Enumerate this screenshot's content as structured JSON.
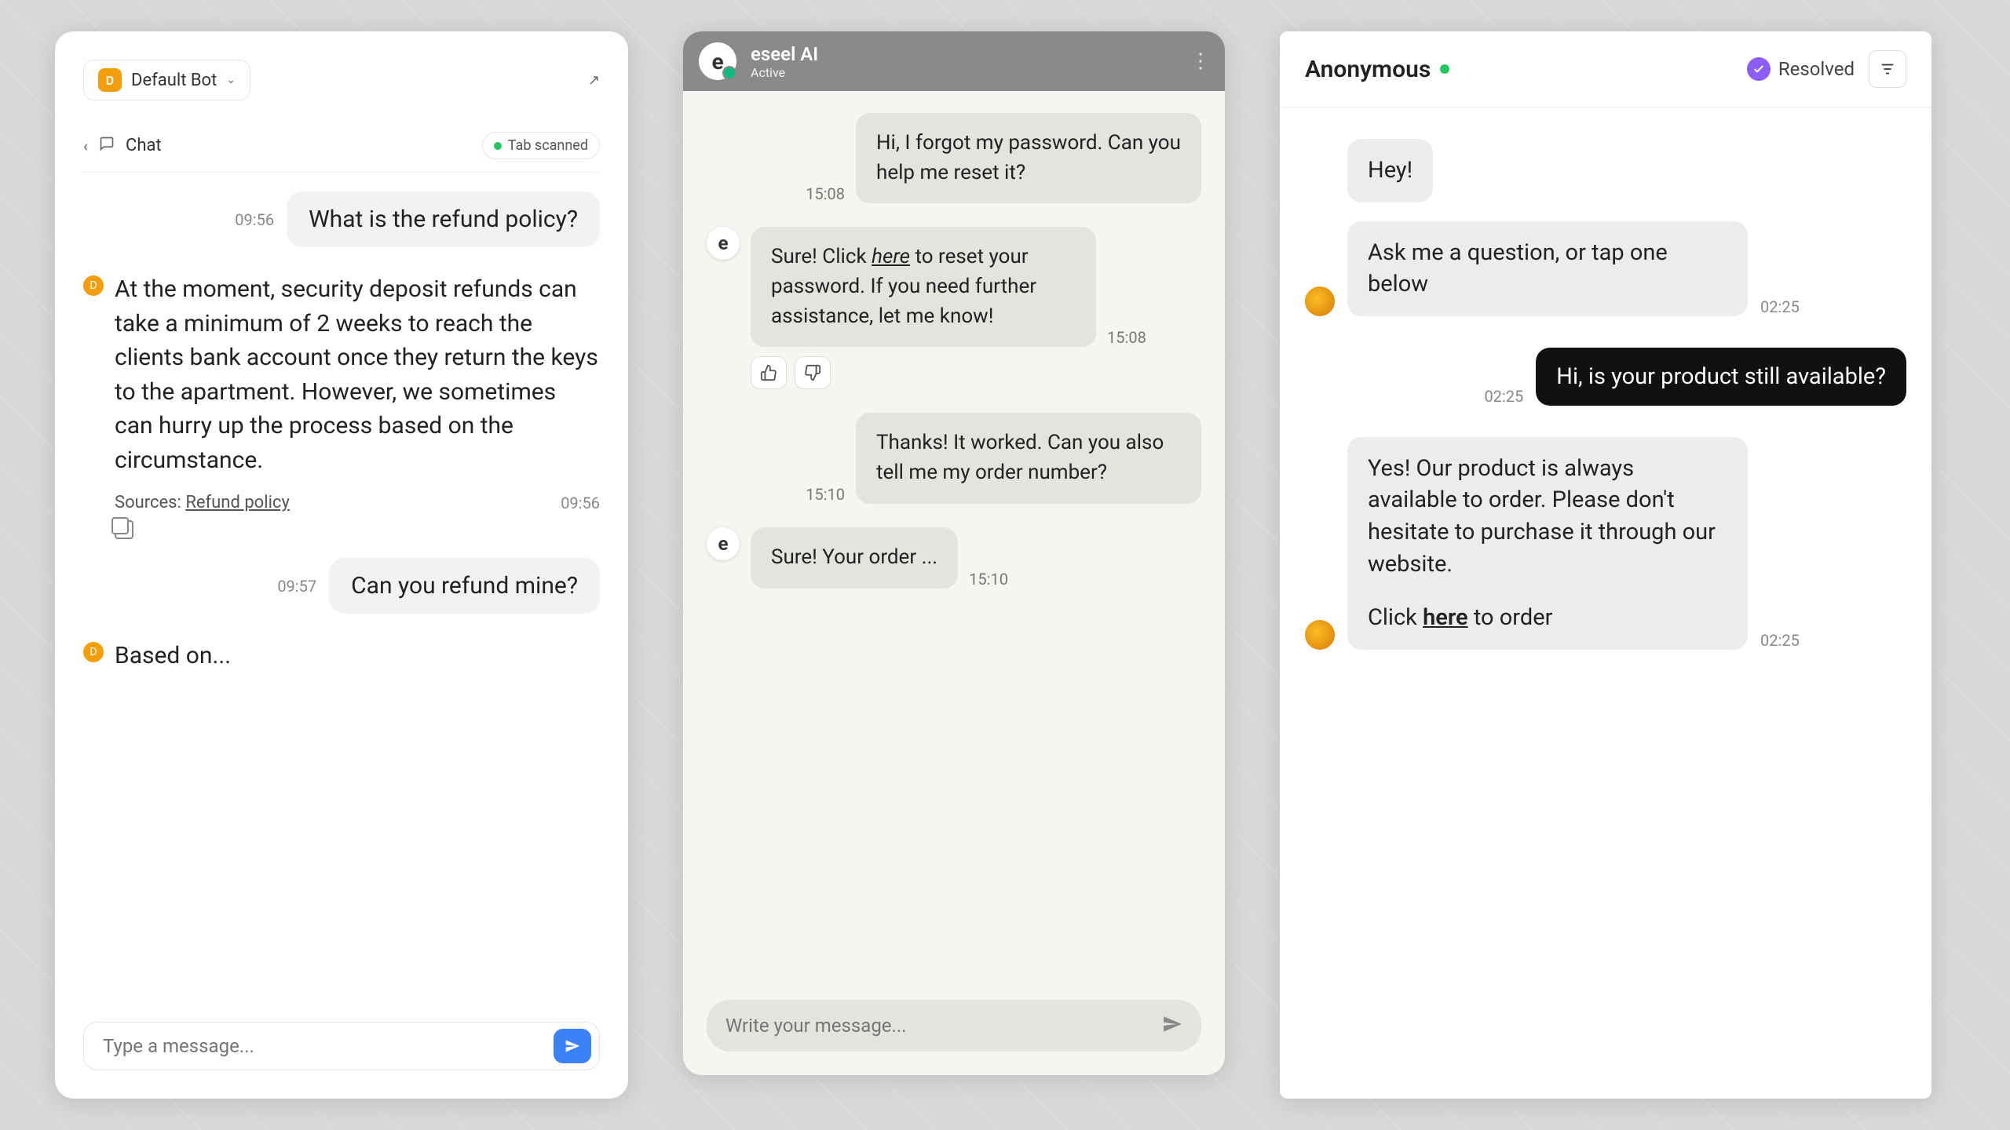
{
  "panel1": {
    "bot": {
      "initial": "D",
      "name": "Default Bot"
    },
    "nav": {
      "label": "Chat",
      "scanBadge": "Tab scanned"
    },
    "messages": {
      "q1": {
        "time": "09:56",
        "text": "What is the refund policy?"
      },
      "a1": {
        "time": "09:56",
        "text": "At the moment, security deposit refunds can take a minimum of 2 weeks to reach the clients bank account once they return the keys to the apartment.  However, we sometimes can hurry up the process based on the circumstance.",
        "sourcesLabel": "Sources: ",
        "sourceLink": "Refund policy"
      },
      "q2": {
        "time": "09:57",
        "text": "Can you refund mine?"
      },
      "a2": {
        "text": "Based on..."
      }
    },
    "input": {
      "placeholder": "Type a message..."
    }
  },
  "panel2": {
    "header": {
      "title": "eseel AI",
      "status": "Active",
      "avatar": "e"
    },
    "messages": {
      "u1": {
        "time": "15:08",
        "text": "Hi, I forgot my password. Can you help me reset it?"
      },
      "b1": {
        "time": "15:08",
        "pre": "Sure! Click ",
        "link": "here",
        "post": " to reset your password. If you need further assistance, let me know!"
      },
      "u2": {
        "time": "15:10",
        "text": "Thanks! It worked. Can you also tell me my order number?"
      },
      "b2": {
        "time": "15:10",
        "text": "Sure! Your order ..."
      }
    },
    "input": {
      "placeholder": "Write your message..."
    }
  },
  "panel3": {
    "header": {
      "name": "Anonymous",
      "resolved": "Resolved"
    },
    "messages": {
      "b1": {
        "text": "Hey!"
      },
      "b2": {
        "time": "02:25",
        "text": "Ask me a question, or tap one below"
      },
      "u1": {
        "time": "02:25",
        "text": "Hi, is your product still available?"
      },
      "b3": {
        "time": "02:25",
        "para1": "Yes! Our product is always available to order. Please don't hesitate to purchase it through our website.",
        "pre": "Click ",
        "link": "here",
        "post": " to order"
      }
    }
  }
}
